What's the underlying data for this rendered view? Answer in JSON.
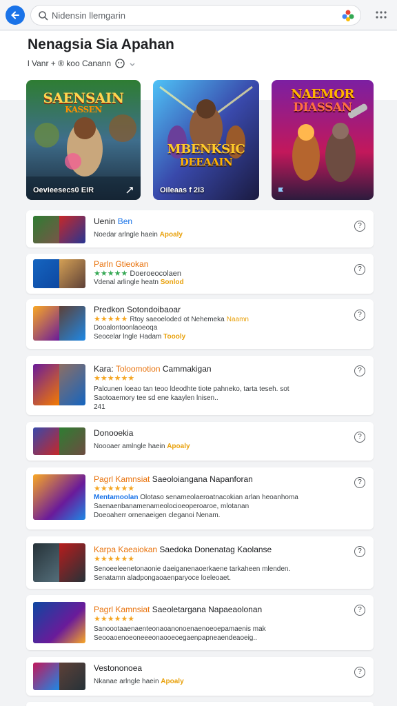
{
  "search": {
    "placeholder": "Nidensin llemgarin"
  },
  "header": {
    "title": "Nenagsia Sia Apahan",
    "subtitle": "l Vanr + ® koo Canann"
  },
  "features": [
    {
      "title_line1": "SAENSAIN",
      "title_line2": "KASSEN",
      "caption": "Oevieesecs0 EIR"
    },
    {
      "title_line1": "MBENKSIC",
      "title_line2": "DEEAAIN",
      "caption": "Oileaas f 2I3"
    },
    {
      "title_line1": "NAEMOR",
      "title_line2": "DIASSAN",
      "caption": ""
    }
  ],
  "rows": [
    {
      "name": "Uenin",
      "name_accent": "Ben",
      "meta": "Noedar arlngle haein",
      "tag": "Apoaly"
    },
    {
      "name": "Parln Gtieokan",
      "stars": "★★★★★",
      "stars_text": "Doeroeocolaen",
      "meta": "Vdenal arlingle heatn",
      "tag": "Sonlod"
    },
    {
      "name": "Predkon Sotondoibaoar",
      "stars": "★★★★★",
      "stars_text": "Rtoy saeoeloded ot Nehemeka",
      "stars_tag": "Naamn",
      "meta": "Dooalontoonlaoeoqa",
      "meta2": "Seocelar lngle Hadam",
      "tag": "Toooly"
    },
    {
      "name": "Kara:",
      "name_accent": "Toloomotion",
      "name_rest": "Cammakigan",
      "stars": "★★★★★★",
      "meta": "Palcunen loeao tan teoo ldeodhte tiote pahneko, tarta teseh. sot",
      "meta2": "Saotoaemory tee sd ene kaaylen lnisen..",
      "meta3": "241"
    },
    {
      "name": "Donooekia",
      "meta": "Noooaer amlngle haein",
      "tag": "Apoaly"
    },
    {
      "name": "Pagrl Kamnsiat",
      "name_rest": "Saeoloiangana Napanforan",
      "stars": "★★★★★★",
      "stars_label": "Mentamoolan",
      "meta": "Olotaso senameolaeroatnacokian arlan heoanhoma",
      "meta2": "Saenaenbanamenameolocioeoperoaroe, mlotanan",
      "meta3": "Doeoaherr ornenaeigen cleganoi Nenam."
    },
    {
      "name": "Karpa Kaeaiokan",
      "name_rest": "Saedoka Donenatag Kaolanse",
      "stars": "★★★★★★",
      "meta": "Senoeeleenetonaonie daeiganenaoerkaene tarkaheen mlenden.",
      "meta2": "Senatamn aladpongaoaenparyoce loeleoaet."
    },
    {
      "name": "Pagrl Kamnsiat",
      "name_rest": "Saeoletargana Napaeaolonan",
      "stars": "★★★★★★",
      "meta": "Sanoootaaenaenteonaoanonoenaenoeoepamaenis mak",
      "meta2": "Seooaoenoeoneeeonaooeoegaenpapneaendeaoeig.."
    },
    {
      "name": "Vestononoea",
      "meta": "Nkanae arlngle haein",
      "tag": "Apoaly"
    }
  ]
}
